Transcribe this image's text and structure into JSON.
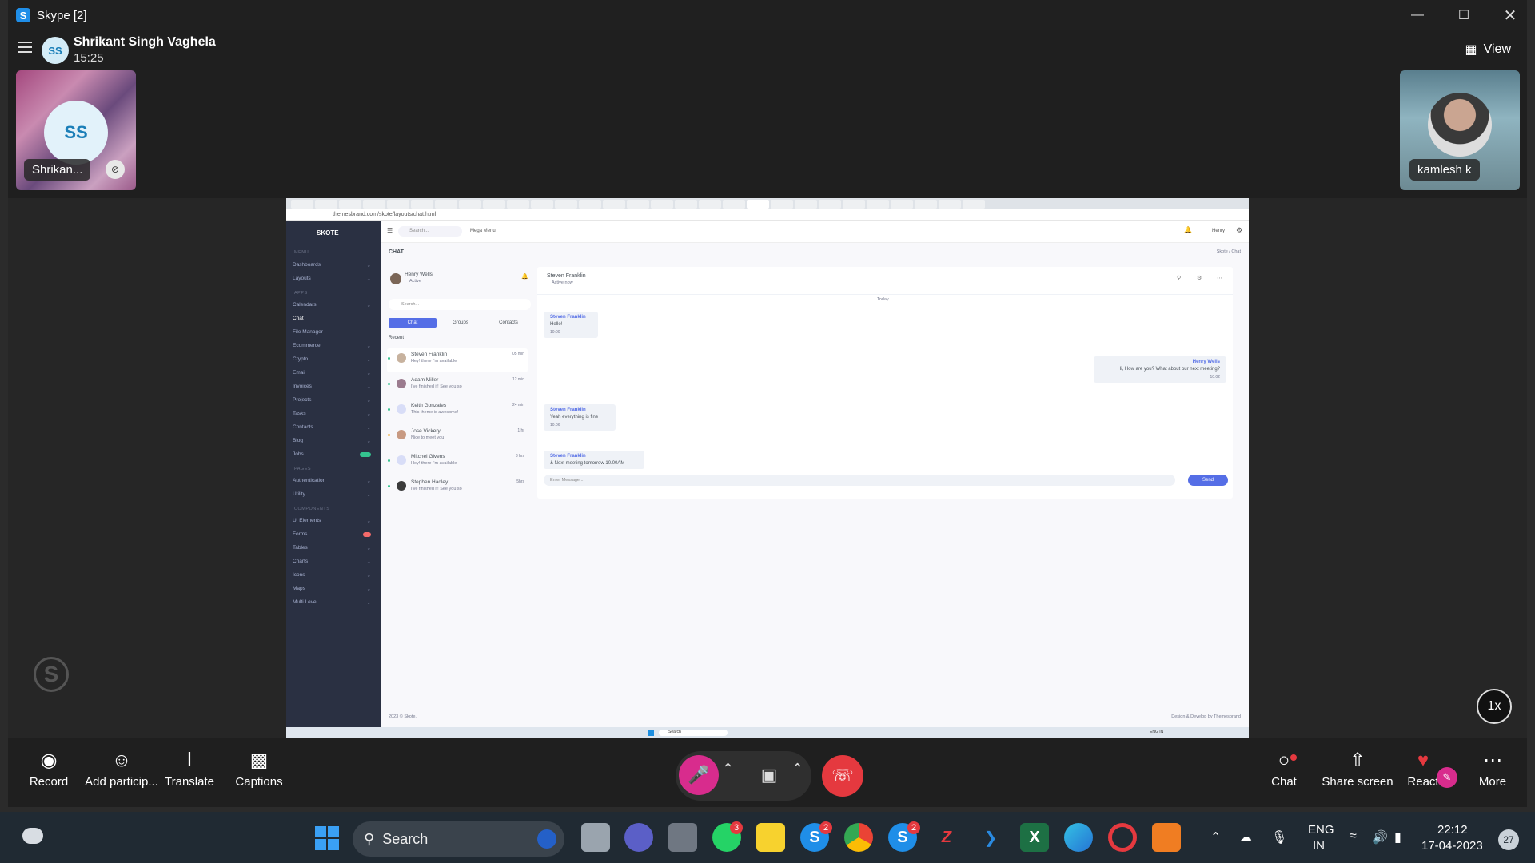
{
  "window": {
    "title": "Skype [2]",
    "app_icon_letter": "S"
  },
  "call": {
    "initials": "SS",
    "name": "Shrikant Singh Vaghela",
    "duration": "15:25",
    "view_label": "View",
    "left_tile_label": "Shrikan...",
    "right_tile_label": "kamlesh k",
    "speed_label": "1x",
    "watermark": "S"
  },
  "toolbar": {
    "record": "Record",
    "add_participants": "Add particip...",
    "translate": "Translate",
    "captions": "Captions",
    "chat": "Chat",
    "share_screen": "Share screen",
    "react": "React",
    "more": "More"
  },
  "shared": {
    "url": "themesbrand.com/skote/layouts/chat.html",
    "brand": "SKOTE",
    "search_placeholder": "Search...",
    "mega_menu": "Mega Menu",
    "user": "Henry",
    "page_title": "CHAT",
    "breadcrumb": "Skote  /  Chat",
    "sidebar_sections": [
      "MENU",
      "APPS",
      "PAGES",
      "COMPONENTS"
    ],
    "sidebar_menu": [
      "Dashboards",
      "Layouts"
    ],
    "sidebar_apps": [
      "Calendars",
      "Chat",
      "File Manager",
      "Ecommerce",
      "Crypto",
      "Email",
      "Invoices",
      "Projects",
      "Tasks",
      "Contacts",
      "Blog",
      "Jobs"
    ],
    "sidebar_pages": [
      "Authentication",
      "Utility"
    ],
    "sidebar_components": [
      "UI Elements",
      "Forms",
      "Tables",
      "Charts",
      "Icons",
      "Maps",
      "Multi Level"
    ],
    "me_name": "Henry Wells",
    "me_status": "Active",
    "chat_search": "Search...",
    "tabs": [
      "Chat",
      "Groups",
      "Contacts"
    ],
    "recent_label": "Recent",
    "contacts": [
      {
        "name": "Steven Franklin",
        "msg": "Hey! there I'm available",
        "time": "05 min"
      },
      {
        "name": "Adam Miller",
        "msg": "I've finished it! See you so",
        "time": "12 min"
      },
      {
        "name": "Keith Gonzales",
        "msg": "This theme is awesome!",
        "time": "24 min"
      },
      {
        "name": "Jose Vickery",
        "msg": "Nice to meet you",
        "time": "1 hr"
      },
      {
        "name": "Mitchel Givens",
        "msg": "Hey! there I'm available",
        "time": "3 hrs"
      },
      {
        "name": "Stephen Hadley",
        "msg": "I've finished it! See you so",
        "time": "5hrs"
      }
    ],
    "conv_name": "Steven Franklin",
    "conv_status": "Active now",
    "today": "Today",
    "messages": [
      {
        "who": "Steven Franklin",
        "text": "Hello!",
        "time": "10:00"
      },
      {
        "who": "Henry Wells",
        "text": "Hi, How are you? What about our next meeting?",
        "time": "10:02"
      },
      {
        "who": "Steven Franklin",
        "text": "Yeah everything is fine",
        "time": "10:06"
      },
      {
        "who": "Steven Franklin",
        "text": "& Next meeting tomorrow 10.00AM",
        "time": ""
      }
    ],
    "input_placeholder": "Enter Message...",
    "send": "Send",
    "footer_left": "2023 © Skote.",
    "footer_right": "Design & Develop by Themesbrand",
    "inner_search": "Search",
    "inner_tray": "ENG IN"
  },
  "taskbar": {
    "search": "Search",
    "lang1": "ENG",
    "lang2": "IN",
    "time": "22:12",
    "date": "17-04-2023",
    "notif_count": "27",
    "whatsapp_badge": "3",
    "skype_badge": "2",
    "skype2_badge": "2"
  },
  "colors": {
    "mic": "#d82c8d",
    "hangup": "#e5393f",
    "accent": "#556ee6"
  }
}
